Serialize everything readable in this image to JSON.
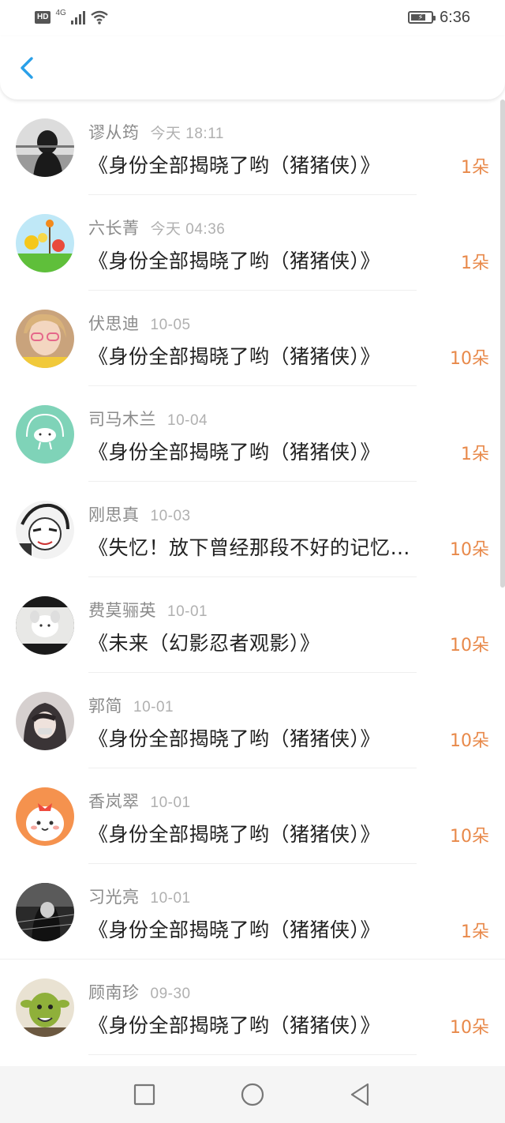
{
  "status_bar": {
    "hd": "HD",
    "network": "4G",
    "time": "6:36"
  },
  "header": {
    "back_icon": "chevron-left-icon",
    "accent_color": "#2aa0e8"
  },
  "items": [
    {
      "name": "谬从筠",
      "date": "今天 18:11",
      "title": "《身份全部揭晓了哟（猪猪侠）》",
      "count": "1朵"
    },
    {
      "name": "六长菁",
      "date": "今天 04:36",
      "title": "《身份全部揭晓了哟（猪猪侠）》",
      "count": "1朵"
    },
    {
      "name": "伏思迪",
      "date": "10-05",
      "title": "《身份全部揭晓了哟（猪猪侠）》",
      "count": "10朵"
    },
    {
      "name": "司马木兰",
      "date": "10-04",
      "title": "《身份全部揭晓了哟（猪猪侠）》",
      "count": "1朵"
    },
    {
      "name": "刚思真",
      "date": "10-03",
      "title": "《失忆！放下曾经那段不好的记忆…",
      "count": "10朵"
    },
    {
      "name": "费莫骊英",
      "date": "10-01",
      "title": "《未来（幻影忍者观影）》",
      "count": "10朵"
    },
    {
      "name": "郭简",
      "date": "10-01",
      "title": "《身份全部揭晓了哟（猪猪侠）》",
      "count": "10朵"
    },
    {
      "name": "香岚翠",
      "date": "10-01",
      "title": "《身份全部揭晓了哟（猪猪侠）》",
      "count": "10朵"
    },
    {
      "name": "习光亮",
      "date": "10-01",
      "title": "《身份全部揭晓了哟（猪猪侠）》",
      "count": "1朵"
    },
    {
      "name": "顾南珍",
      "date": "09-30",
      "title": "《身份全部揭晓了哟（猪猪侠）》",
      "count": "10朵"
    }
  ],
  "colors": {
    "count": "#e8894a",
    "name": "#8a8a8a",
    "date": "#b0b0b0"
  },
  "navbar": {
    "icons": [
      "square-icon",
      "circle-icon",
      "triangle-back-icon"
    ]
  }
}
